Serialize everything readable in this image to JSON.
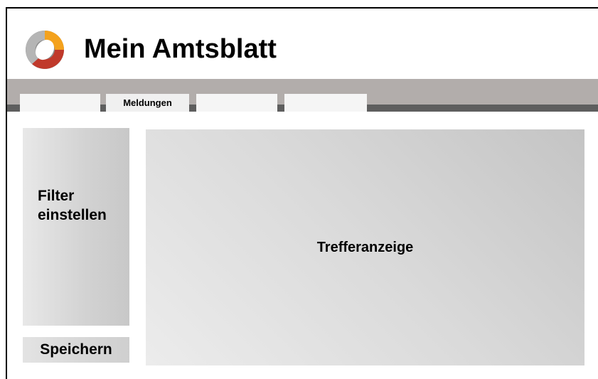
{
  "app": {
    "title": "Mein Amtsblatt",
    "logo_icon": "amtsblatt-logo-icon"
  },
  "nav": {
    "tabs": [
      {
        "label": ""
      },
      {
        "label": "Meldungen",
        "active": true
      },
      {
        "label": ""
      },
      {
        "label": ""
      }
    ]
  },
  "sidebar": {
    "filter_label": "Filter\neinstellen",
    "save_label": "Speichern"
  },
  "main": {
    "results_label": "Trefferanzeige"
  },
  "colors": {
    "nav_bar": "#b2adab",
    "nav_stripe": "#5e5e5e",
    "logo_orange": "#f4a21d",
    "logo_red": "#c0392b",
    "logo_grey": "#8c8c8c"
  }
}
